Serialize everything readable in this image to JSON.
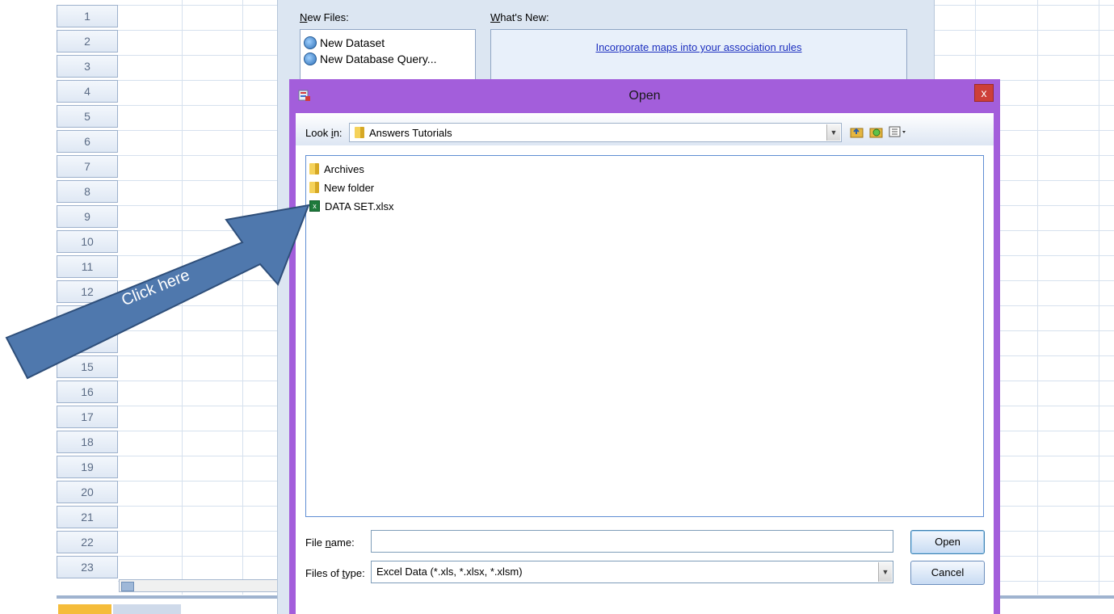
{
  "sheet": {
    "rows": [
      "1",
      "2",
      "3",
      "4",
      "5",
      "6",
      "7",
      "8",
      "9",
      "10",
      "11",
      "12",
      "",
      "",
      "15",
      "16",
      "17",
      "18",
      "19",
      "20",
      "21",
      "22",
      "23"
    ]
  },
  "welcome": {
    "new_files_label": "New Files:",
    "whats_new_label": "What's New:",
    "new_files": [
      "New Dataset",
      "New Database Query..."
    ],
    "whats_new_link": "Incorporate maps into your association rules"
  },
  "dialog": {
    "title": "Open",
    "close_glyph": "x",
    "look_in_label": "Look in:",
    "look_in_value": "Answers Tutorials",
    "files": [
      {
        "name": "Archives",
        "type": "folder"
      },
      {
        "name": "New folder",
        "type": "folder"
      },
      {
        "name": "DATA SET.xlsx",
        "type": "excel"
      }
    ],
    "file_name_label": "File name:",
    "file_name_value": "",
    "files_of_type_label": "Files of type:",
    "files_of_type_value": "Excel Data (*.xls, *.xlsx, *.xlsm)",
    "open_button": "Open",
    "cancel_button": "Cancel"
  },
  "annotation": {
    "text": "Click here",
    "color": "#4f78ad",
    "border_color": "#2f4f7a"
  },
  "icons": {
    "folder": "folder-icon",
    "excel": "excel-file-icon",
    "up_folder": "up-folder-icon",
    "new_folder": "new-folder-icon",
    "view_menu": "view-menu-icon"
  }
}
